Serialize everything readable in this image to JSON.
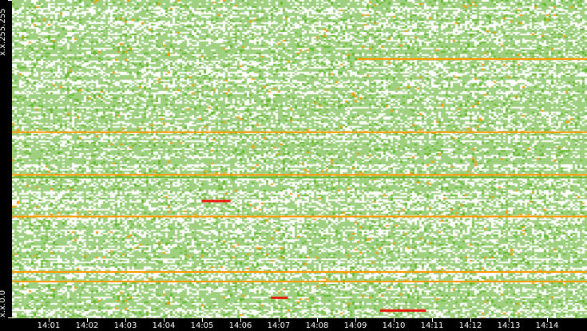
{
  "chart_data": {
    "type": "heatmap",
    "title": "",
    "y_axis": {
      "top_label": "x.x.255.255",
      "bottom_label": "x.x.0.0",
      "range": [
        0,
        65535
      ]
    },
    "x_axis": {
      "ticks": [
        "14:01",
        "14:02",
        "14:03",
        "14:04",
        "14:05",
        "14:06",
        "14:07",
        "14:08",
        "14:09",
        "14:10",
        "14:11",
        "14:12",
        "14:13",
        "14:14"
      ],
      "range_minutes": [
        14.0,
        15.0
      ]
    },
    "colors": {
      "background": "#000000",
      "empty": "#ffffff",
      "low": "#9fd07f",
      "medium": "#66b82e",
      "high": "#ff9900",
      "peak": "#e8180c"
    },
    "highlight_rows": [
      {
        "row": 0.817,
        "start": 0.6,
        "end": 1.0,
        "level": "high"
      },
      {
        "row": 0.587,
        "start": 0.0,
        "end": 1.0,
        "level": "high"
      },
      {
        "row": 0.453,
        "start": 0.0,
        "end": 1.0,
        "level": "high"
      },
      {
        "row": 0.445,
        "start": 0.0,
        "end": 1.0,
        "level": "medium"
      },
      {
        "row": 0.322,
        "start": 0.0,
        "end": 1.0,
        "level": "high"
      },
      {
        "row": 0.148,
        "start": 0.0,
        "end": 1.0,
        "level": "high"
      },
      {
        "row": 0.118,
        "start": 0.0,
        "end": 1.0,
        "level": "high"
      },
      {
        "row": 0.068,
        "start": 0.45,
        "end": 0.48,
        "level": "peak"
      },
      {
        "row": 0.028,
        "start": 0.64,
        "end": 0.72,
        "level": "peak"
      },
      {
        "row": 0.372,
        "start": 0.33,
        "end": 0.38,
        "level": "peak"
      }
    ]
  }
}
